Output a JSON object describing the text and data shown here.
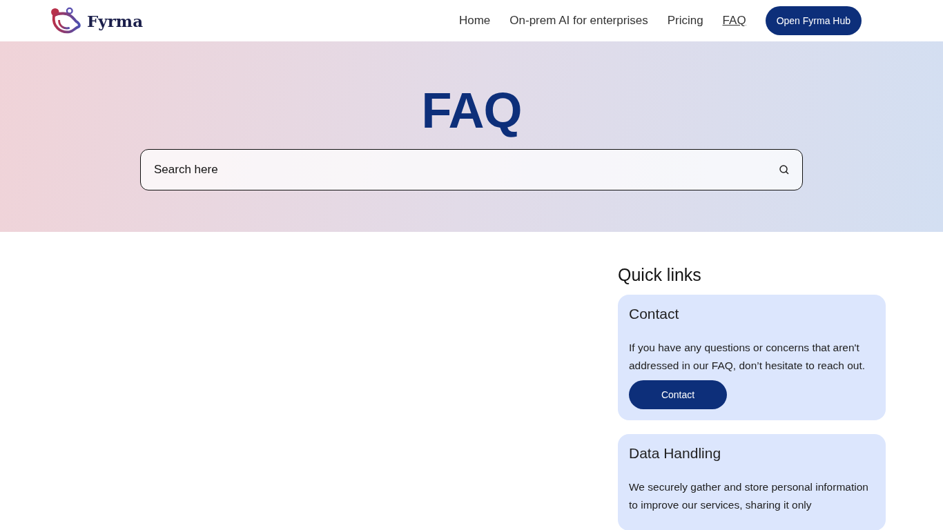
{
  "header": {
    "logo_text": "Fyrma",
    "nav": [
      {
        "label": "Home",
        "selected": false
      },
      {
        "label": "On-prem AI for enterprises",
        "selected": false
      },
      {
        "label": "Pricing",
        "selected": false
      },
      {
        "label": "FAQ",
        "selected": true
      }
    ],
    "cta": "Open Fyrma Hub"
  },
  "hero": {
    "title": "FAQ",
    "search": {
      "placeholder": "Search here"
    }
  },
  "quick_links": {
    "title": "Quick links",
    "cards": [
      {
        "title": "Contact",
        "text": "If you have any questions or concerns that aren't addressed in our FAQ, don’t hesitate to reach out.",
        "button": "Contact"
      },
      {
        "title": "Data Handling",
        "text": "We securely gather and store personal information to improve our services, sharing it only"
      }
    ]
  }
}
